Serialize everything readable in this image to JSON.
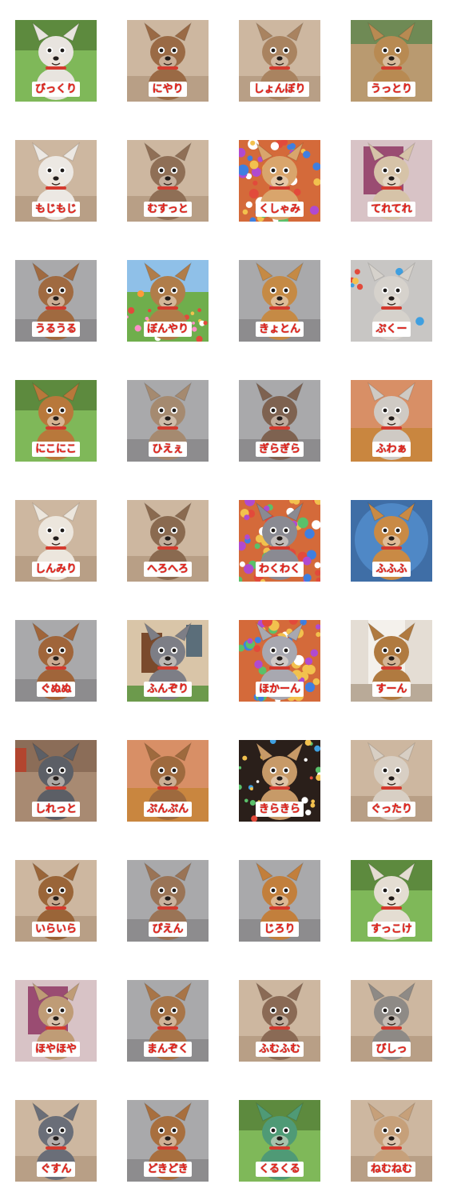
{
  "stickers": [
    {
      "label": "びっくり",
      "bg": "grass",
      "dog": "#e8e4df"
    },
    {
      "label": "にやり",
      "bg": "beige",
      "dog": "#9a6a45"
    },
    {
      "label": "しょんぼり",
      "bg": "beige",
      "dog": "#a98360"
    },
    {
      "label": "うっとり",
      "bg": "tan",
      "dog": "#b88a52"
    },
    {
      "label": "もじもじ",
      "bg": "beige",
      "dog": "#ece8e3"
    },
    {
      "label": "むすっと",
      "bg": "beige",
      "dog": "#8f6f56"
    },
    {
      "label": "くしゃみ",
      "bg": "confetti",
      "dog": "#d9a56c"
    },
    {
      "label": "てれてれ",
      "bg": "pink",
      "dog": "#d6c3a8"
    },
    {
      "label": "うるうる",
      "bg": "gray",
      "dog": "#a06a40"
    },
    {
      "label": "ぼんやり",
      "bg": "flowers",
      "dog": "#b07d4a"
    },
    {
      "label": "きょとん",
      "bg": "gray",
      "dog": "#c58a45"
    },
    {
      "label": "ぷくー",
      "bg": "balls",
      "dog": "#d6d2cc"
    },
    {
      "label": "にこにこ",
      "bg": "grass",
      "dog": "#b8783b"
    },
    {
      "label": "ひえぇ",
      "bg": "gray",
      "dog": "#a58a70"
    },
    {
      "label": "ぎらぎら",
      "bg": "gray",
      "dog": "#7e6250"
    },
    {
      "label": "ふわぁ",
      "bg": "warm",
      "dog": "#cfcac4"
    },
    {
      "label": "しんみり",
      "bg": "beige",
      "dog": "#ece6dd"
    },
    {
      "label": "へろへろ",
      "bg": "beige",
      "dog": "#8a6a50"
    },
    {
      "label": "わくわく",
      "bg": "confetti",
      "dog": "#8a8a92"
    },
    {
      "label": "ふふふ",
      "bg": "blue",
      "dog": "#c98a45"
    },
    {
      "label": "ぐぬぬ",
      "bg": "gray",
      "dog": "#a0653a"
    },
    {
      "label": "ふんぞり",
      "bg": "house",
      "dog": "#7d7e86"
    },
    {
      "label": "ほかーん",
      "bg": "confetti",
      "dog": "#a8a8b0"
    },
    {
      "label": "すーん",
      "bg": "door",
      "dog": "#b07a40"
    },
    {
      "label": "しれっと",
      "bg": "sofa",
      "dog": "#5c5f66"
    },
    {
      "label": "ぷんぷん",
      "bg": "warm",
      "dog": "#9e6a3e"
    },
    {
      "label": "きらきら",
      "bg": "dark",
      "dog": "#c79a68"
    },
    {
      "label": "ぐったり",
      "bg": "beige",
      "dog": "#d8cfc4"
    },
    {
      "label": "いらいら",
      "bg": "beige",
      "dog": "#9a6538"
    },
    {
      "label": "ぴえん",
      "bg": "gray",
      "dog": "#9a7456"
    },
    {
      "label": "じろり",
      "bg": "gray",
      "dog": "#c27f3c"
    },
    {
      "label": "すっこけ",
      "bg": "grass",
      "dog": "#e4ddd2"
    },
    {
      "label": "ほやほや",
      "bg": "pink",
      "dog": "#bf9c76"
    },
    {
      "label": "まんぞく",
      "bg": "gray",
      "dog": "#a87548"
    },
    {
      "label": "ふむふむ",
      "bg": "beige",
      "dog": "#8a6a55"
    },
    {
      "label": "びしっ",
      "bg": "beige",
      "dog": "#8e8a86"
    },
    {
      "label": "ぐすん",
      "bg": "beige",
      "dog": "#6a6e78"
    },
    {
      "label": "どきどき",
      "bg": "gray",
      "dog": "#a86f3e"
    },
    {
      "label": "くるくる",
      "bg": "grass",
      "dog": "#4f9a76"
    },
    {
      "label": "ねむねむ",
      "bg": "beige",
      "dog": "#c6a07a"
    }
  ]
}
